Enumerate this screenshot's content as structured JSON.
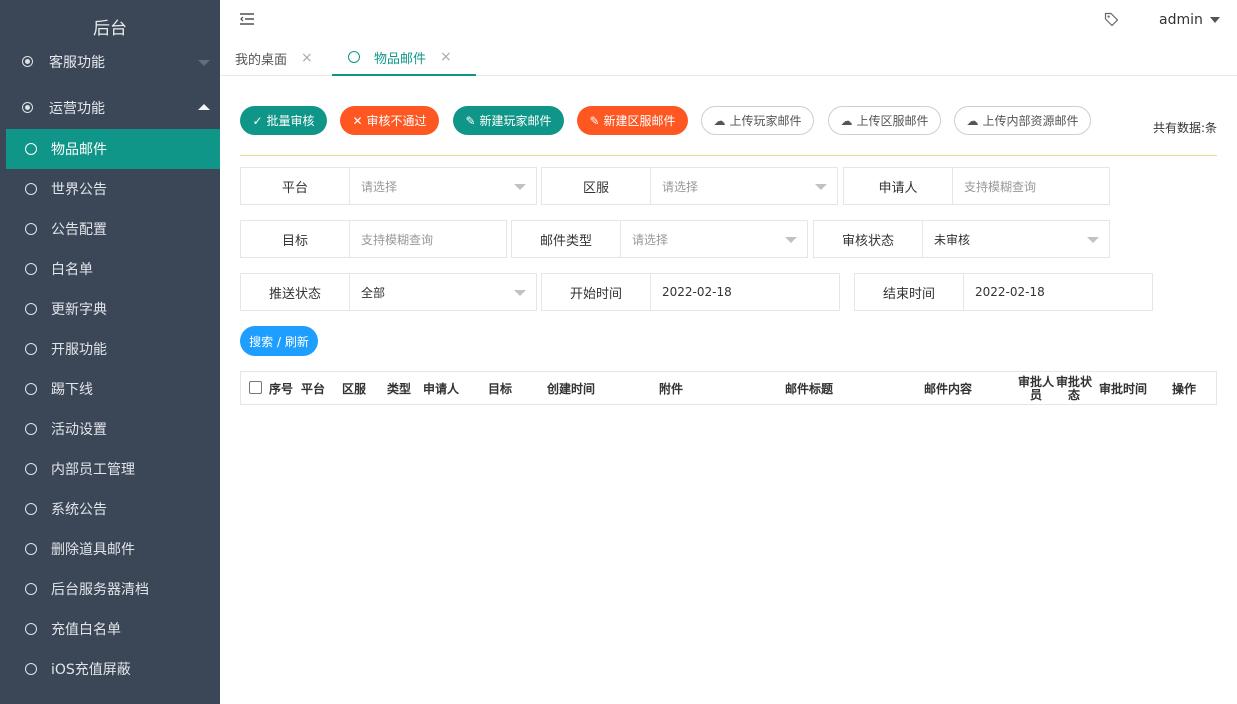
{
  "sidebar": {
    "brand": "后台",
    "groups": [
      {
        "label": "客服功能"
      },
      {
        "label": "运营功能"
      }
    ],
    "items": [
      {
        "label": "物品邮件"
      },
      {
        "label": "世界公告"
      },
      {
        "label": "公告配置"
      },
      {
        "label": "白名单"
      },
      {
        "label": "更新字典"
      },
      {
        "label": "开服功能"
      },
      {
        "label": "踢下线"
      },
      {
        "label": "活动设置"
      },
      {
        "label": "内部员工管理"
      },
      {
        "label": "系统公告"
      },
      {
        "label": "删除道具邮件"
      },
      {
        "label": "后台服务器清档"
      },
      {
        "label": "充值白名单"
      },
      {
        "label": "iOS充值屏蔽"
      }
    ]
  },
  "header": {
    "user": "admin"
  },
  "tabs": [
    {
      "label": "我的桌面",
      "close": "×"
    },
    {
      "label": "物品邮件",
      "close": "×"
    }
  ],
  "toolbar": {
    "buttons": [
      {
        "label": "批量审核"
      },
      {
        "label": "审核不通过"
      },
      {
        "label": "新建玩家邮件"
      },
      {
        "label": "新建区服邮件"
      },
      {
        "label": "上传玩家邮件"
      },
      {
        "label": "上传区服邮件"
      },
      {
        "label": "上传内部资源邮件"
      }
    ],
    "count": "共有数据:条"
  },
  "filters": {
    "platform": {
      "label": "平台",
      "value": "请选择"
    },
    "zone": {
      "label": "区服",
      "value": "请选择"
    },
    "applicant": {
      "label": "申请人",
      "value": "支持模糊查询"
    },
    "target": {
      "label": "目标",
      "value": "支持模糊查询"
    },
    "mail_type": {
      "label": "邮件类型",
      "value": "请选择"
    },
    "review_status": {
      "label": "审核状态",
      "value": "未审核"
    },
    "push_status": {
      "label": "推送状态",
      "value": "全部"
    },
    "start_time": {
      "label": "开始时间",
      "value": "2022-02-18"
    },
    "end_time": {
      "label": "结束时间",
      "value": "2022-02-18"
    }
  },
  "search_button": "搜索 / 刷新",
  "table": {
    "columns": [
      "序号",
      "平台",
      "区服",
      "类型",
      "申请人",
      "目标",
      "创建时间",
      "附件",
      "邮件标题",
      "邮件内容",
      "审批人员",
      "审批状态",
      "审批时间",
      "操作"
    ]
  },
  "colors": {
    "sidebar_bg": "#3b4656",
    "accent_teal": "#109688",
    "warn_orange": "#ff5722",
    "search_blue": "#1e9fff"
  }
}
